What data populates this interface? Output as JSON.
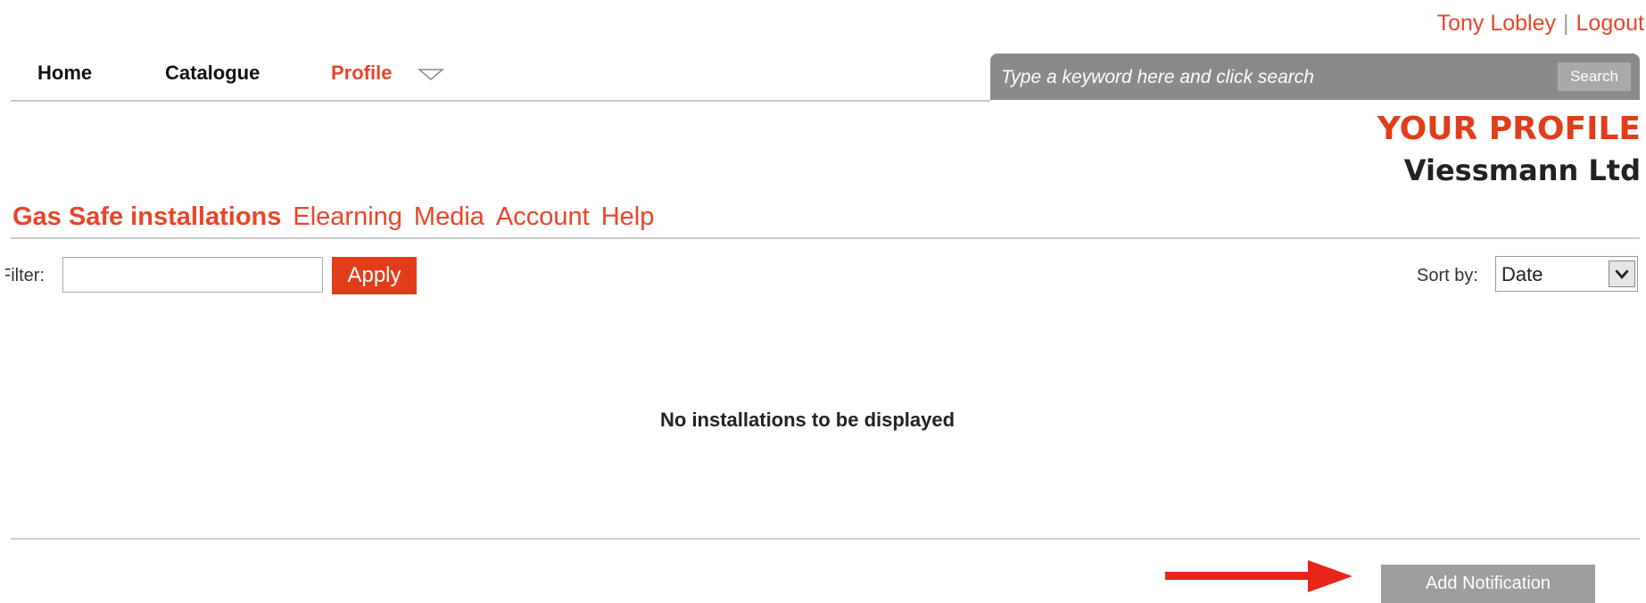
{
  "user": {
    "name": "Tony Lobley",
    "separator": "|",
    "logout": "Logout"
  },
  "nav": {
    "items": [
      {
        "label": "Home"
      },
      {
        "label": "Catalogue"
      },
      {
        "label": "Profile",
        "active": true,
        "icon": "chevron-down-icon"
      }
    ]
  },
  "search": {
    "placeholder": "Type a keyword here and click search",
    "button": "Search"
  },
  "header": {
    "title": "YOUR PROFILE",
    "subtitle": "Viessmann Ltd"
  },
  "subnav": {
    "items": [
      {
        "label": "Gas Safe installations",
        "active": true
      },
      {
        "label": "Elearning"
      },
      {
        "label": "Media"
      },
      {
        "label": "Account"
      },
      {
        "label": "Help"
      }
    ]
  },
  "filter": {
    "label": "Filter:",
    "value": "",
    "apply": "Apply"
  },
  "sort": {
    "label": "Sort by:",
    "selected": "Date"
  },
  "empty_message": "No installations to be displayed",
  "actions": {
    "add_notification": "Add Notification"
  },
  "colors": {
    "accent": "#e23d1a",
    "link": "#e8452a",
    "search_bg": "#8a8a8a",
    "button_grey": "#9e9e9e"
  },
  "annotations": [
    {
      "type": "arrow",
      "color": "#e8251a",
      "points_to": "add-notification-button"
    }
  ]
}
